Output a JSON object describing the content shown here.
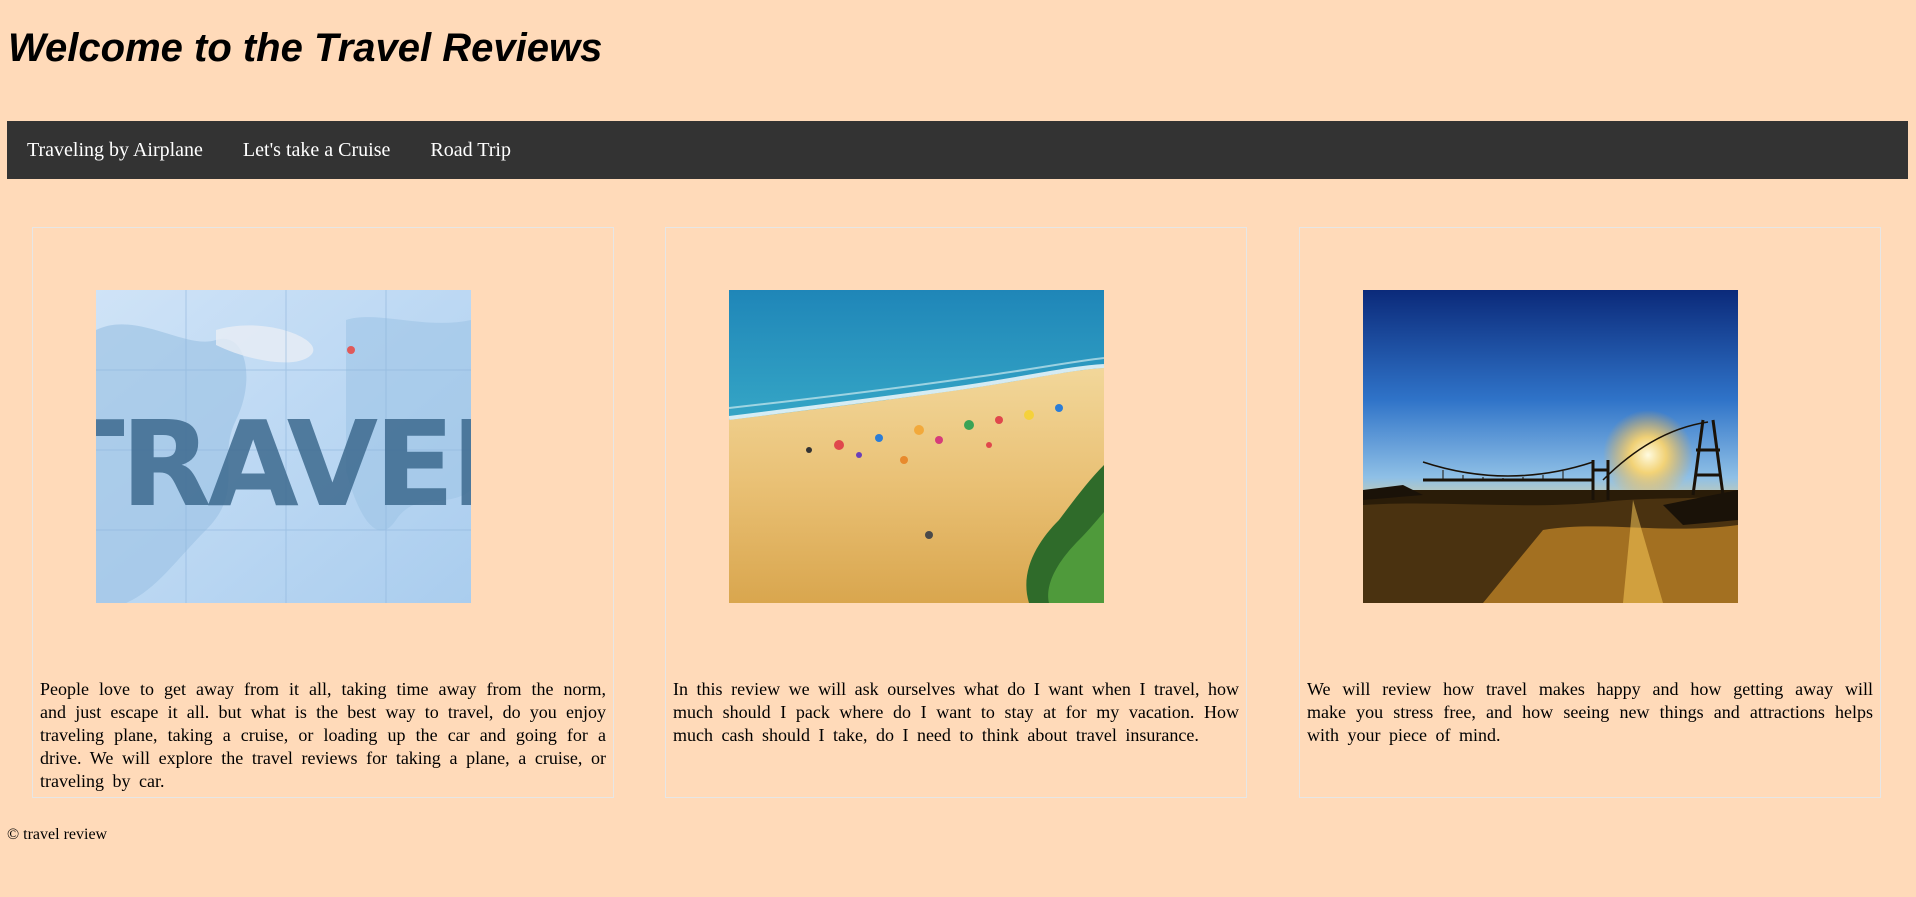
{
  "page": {
    "title": "Welcome to the Travel Reviews",
    "background_color": "#ffdab9"
  },
  "navbar": {
    "background_color": "#333333",
    "items": [
      {
        "label": "Traveling by Airplane"
      },
      {
        "label": "Let's take a Cruise"
      },
      {
        "label": "Road Trip"
      }
    ]
  },
  "cards": [
    {
      "image_icon": "travel-map-image",
      "image_text": "TRAVEL",
      "text": "People love to get away from it all, taking time away from the norm, and just escape it all. but what is the best way to travel, do you enjoy traveling plane, taking a cruise, or loading up the car and going for a drive. We will explore the travel reviews for taking a plane, a cruise, or traveling by car."
    },
    {
      "image_icon": "beach-image",
      "text": "In this review we will ask ourselves what do I want when I travel, how much should I pack where do I want to stay at for my vacation. How much cash should I take, do I need to think about travel insurance."
    },
    {
      "image_icon": "sunset-bridge-image",
      "text": "We will review how travel makes happy and how getting away will make you stress free, and how seeing new things and attractions helps with your piece of mind."
    }
  ],
  "footer": {
    "text": "© travel review"
  }
}
